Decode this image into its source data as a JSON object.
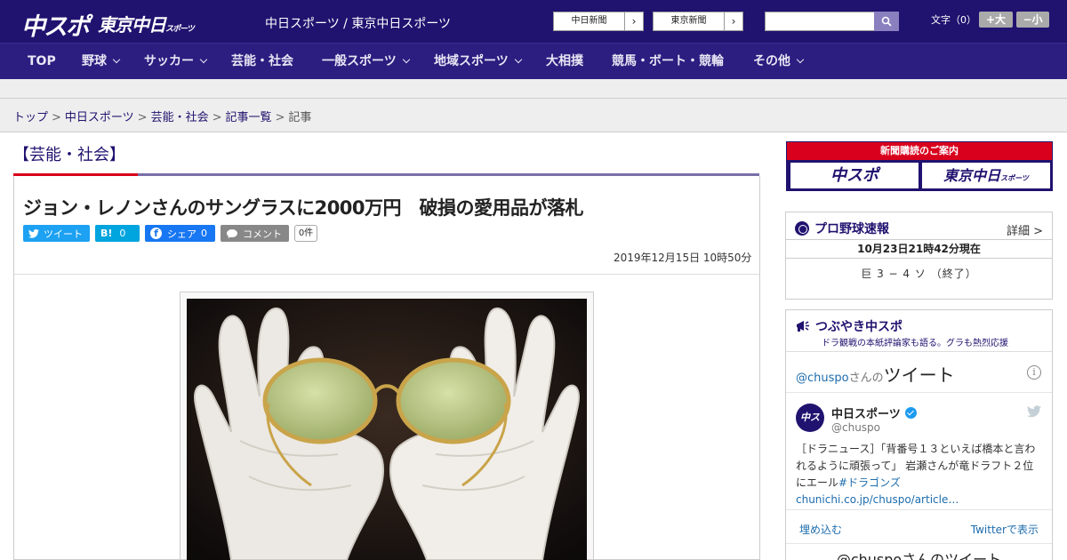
{
  "header": {
    "logo_main": "中スポ",
    "logo_tokyo": "東京中日",
    "logo_tokyo_small": "スポーツ",
    "site_title": "中日スポーツ / 東京中日スポーツ",
    "ext_links": [
      "中日新聞",
      "東京新聞"
    ],
    "search_placeholder": "",
    "font_size_label": "文字（0）",
    "font_bigger": "+大",
    "font_smaller": "−小"
  },
  "nav": {
    "items": [
      "TOP",
      "野球",
      "サッカー",
      "芸能・社会",
      "一般スポーツ",
      "地域スポーツ",
      "大相撲",
      "競馬・ボート・競輪",
      "その他"
    ]
  },
  "breadcrumb": {
    "items": [
      "トップ",
      "中日スポーツ",
      "芸能・社会",
      "記事一覧"
    ],
    "current": "記事",
    "separator": ">"
  },
  "article": {
    "category": "【芸能・社会】",
    "headline": "ジョン・レノンさんのサングラスに2000万円　破損の愛用品が落札",
    "share": {
      "tweet": "ツイート",
      "hatena": "B!",
      "hatena_count": "0",
      "facebook": "シェア",
      "facebook_count": "0",
      "comment": "コメント",
      "comment_count": "0件"
    },
    "datetime": "2019年12月15日 10時50分"
  },
  "sidebar": {
    "subscribe": {
      "title": "新聞購読のご案内",
      "btn1": "中スポ",
      "btn2": "東京中日",
      "btn2_small": "スポーツ"
    },
    "baseball": {
      "title": "プロ野球速報",
      "detail": "詳細 >",
      "timestamp": "10月23日21時42分現在",
      "score": "巨 3 − 4 ソ （終了）"
    },
    "tweets": {
      "title": "つぶやき中スポ",
      "subtitle": "ドラ観戦の本紙評論家も語る。グラも熱烈応援",
      "handle": "@chuspo",
      "handle_suffix": "さんの",
      "tweets_label": "ツイート",
      "info": "i",
      "avatar_text": "中スポ",
      "name": "中日スポーツ",
      "at": "@chuspo",
      "body_prefix": "［ドラニュース］「背番号１３といえば橋本と言われるように頑張って」 岩瀬さんが竜ドラフト２位にエール",
      "body_link": "#ドラゴンズchunichi.co.jp/chuspo/article…",
      "embed": "埋め込む",
      "view": "Twitterで表示",
      "more": "@chuspoさんのツイート"
    }
  },
  "colors": {
    "brand": "#20126f",
    "nav": "#2c1d80",
    "accent_red": "#d8001c",
    "twitter": "#1da1f2",
    "facebook": "#1877f2",
    "hatena": "#00a4de"
  }
}
